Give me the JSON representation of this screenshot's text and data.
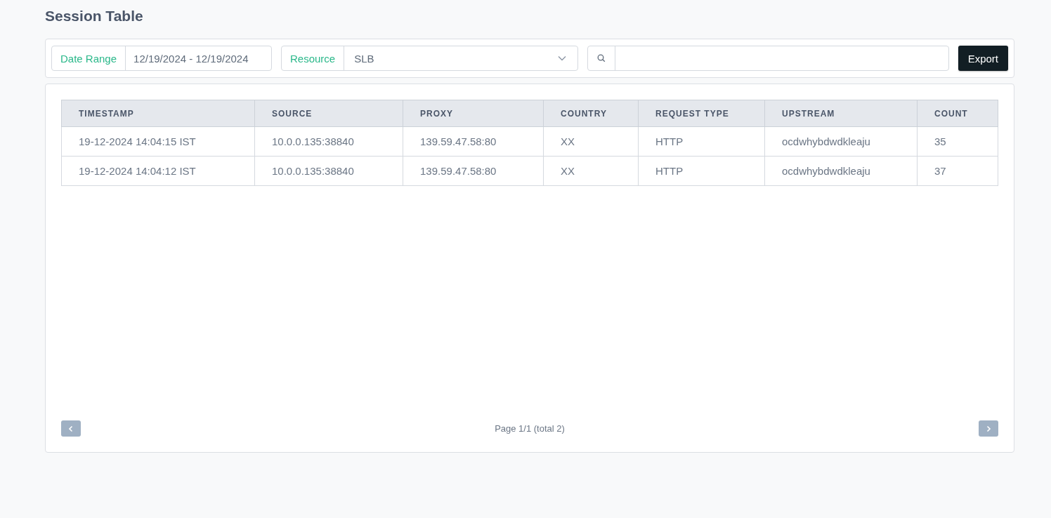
{
  "title": "Session Table",
  "filters": {
    "date_range": {
      "label": "Date Range",
      "value": "12/19/2024 - 12/19/2024"
    },
    "resource": {
      "label": "Resource",
      "value": "SLB"
    },
    "export_button": "Export"
  },
  "table": {
    "columns": [
      "TIMESTAMP",
      "SOURCE",
      "PROXY",
      "COUNTRY",
      "REQUEST TYPE",
      "UPSTREAM",
      "COUNT"
    ],
    "rows": [
      [
        "19-12-2024 14:04:15 IST",
        "10.0.0.135:38840",
        "139.59.47.58:80",
        "XX",
        "HTTP",
        "ocdwhybdwdkleaju",
        "35"
      ],
      [
        "19-12-2024 14:04:12 IST",
        "10.0.0.135:38840",
        "139.59.47.58:80",
        "XX",
        "HTTP",
        "ocdwhybdwdkleaju",
        "37"
      ]
    ]
  },
  "pagination": {
    "prev": {
      "disabled": true
    },
    "info": "Page 1/1 (total 2)",
    "next": {
      "disabled": true
    }
  }
}
